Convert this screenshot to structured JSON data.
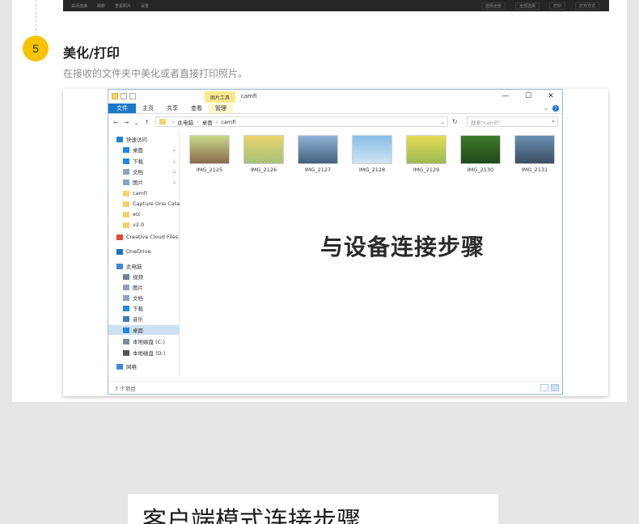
{
  "top_toolbar": {
    "left_items": [
      "关闭连接",
      "刷新",
      "查看照片",
      "设置"
    ],
    "right_items": [
      "选择全部",
      "全部选择",
      "打印",
      "打开方式"
    ]
  },
  "step": {
    "number": "5",
    "title": "美化/打印",
    "description": "在接收的文件夹中美化或者直接打印照片。"
  },
  "explorer": {
    "context_tab": "图片工具",
    "window_title": "camfi",
    "window_controls": {
      "minimize": "—",
      "maximize": "☐",
      "close": "✕"
    },
    "ribbon": {
      "file": "文件",
      "tabs": [
        "主页",
        "共享",
        "查看"
      ],
      "manage": "管理",
      "expand": "⌄",
      "help": "?"
    },
    "nav_buttons": {
      "back": "←",
      "forward": "→",
      "recent": "⌄",
      "up": "↑"
    },
    "address": {
      "segments": [
        "此电脑",
        "桌面",
        "camfi"
      ],
      "separator": "›",
      "dropdown": "⌄"
    },
    "refresh": "↻",
    "search": {
      "placeholder": "搜索\"camfi\"",
      "icon": "⌕"
    },
    "nav_items": [
      {
        "label": "快速访问",
        "icon": "star-icon",
        "color": "#2a7fd4",
        "pinned": false
      },
      {
        "label": "桌面",
        "icon": "desktop-icon",
        "color": "#1e88e5",
        "pinned": true
      },
      {
        "label": "下载",
        "icon": "download-icon",
        "color": "#1e88e5",
        "pinned": true
      },
      {
        "label": "文档",
        "icon": "document-icon",
        "color": "#8aa4c0",
        "pinned": true
      },
      {
        "label": "图片",
        "icon": "pictures-icon",
        "color": "#8aa4c0",
        "pinned": true
      },
      {
        "label": "camfi",
        "icon": "folder-icon",
        "color": "#f5d36b",
        "pinned": false
      },
      {
        "label": "Capture One Cata",
        "icon": "folder-icon",
        "color": "#f5d36b",
        "pinned": false
      },
      {
        "label": "etc",
        "icon": "folder-icon",
        "color": "#f5d36b",
        "pinned": false
      },
      {
        "label": "v2.0",
        "icon": "folder-icon",
        "color": "#f5d36b",
        "pinned": false
      },
      {
        "label": "Creative Cloud Files",
        "icon": "creative-cloud-icon",
        "color": "#e04a3a",
        "pinned": false
      },
      {
        "label": "OneDrive",
        "icon": "onedrive-icon",
        "color": "#1e70c8",
        "pinned": false
      },
      {
        "label": "此电脑",
        "icon": "computer-icon",
        "color": "#3b8ad8",
        "pinned": false
      },
      {
        "label": "视频",
        "icon": "video-icon",
        "color": "#6a7f96",
        "pinned": false
      },
      {
        "label": "图片",
        "icon": "pictures-icon",
        "color": "#8aa4c0",
        "pinned": false
      },
      {
        "label": "文档",
        "icon": "document-icon",
        "color": "#8aa4c0",
        "pinned": false
      },
      {
        "label": "下载",
        "icon": "download-icon",
        "color": "#1e88e5",
        "pinned": false
      },
      {
        "label": "音乐",
        "icon": "music-icon",
        "color": "#3a78c2",
        "pinned": false
      },
      {
        "label": "桌面",
        "icon": "desktop-icon",
        "color": "#1e88e5",
        "pinned": false,
        "selected": true
      },
      {
        "label": "本地磁盘 (C:)",
        "icon": "drive-icon",
        "color": "#7a8a99",
        "pinned": false
      },
      {
        "label": "本地磁盘 (D:)",
        "icon": "drive-icon",
        "color": "#555555",
        "pinned": false
      },
      {
        "label": "网络",
        "icon": "network-icon",
        "color": "#3b8ad8",
        "pinned": false
      }
    ],
    "pin_symbol": "⊥",
    "files": [
      {
        "name": "IMG_2125",
        "colors": [
          "#c9d98a",
          "#8a6a4a"
        ]
      },
      {
        "name": "IMG_2126",
        "colors": [
          "#e8d46a",
          "#a8c07a"
        ]
      },
      {
        "name": "IMG_2127",
        "colors": [
          "#8fb3d6",
          "#41627f"
        ]
      },
      {
        "name": "IMG_2128",
        "colors": [
          "#87bde8",
          "#cfe4f2"
        ]
      },
      {
        "name": "IMG_2129",
        "colors": [
          "#e5dc55",
          "#9cba52"
        ]
      },
      {
        "name": "IMG_2130",
        "colors": [
          "#3f7a2c",
          "#1f4a18"
        ]
      },
      {
        "name": "IMG_2131",
        "colors": [
          "#6a8eb2",
          "#3c4f64"
        ]
      }
    ],
    "overlay_text": "与设备连接步骤",
    "status_text": "7 个项目"
  },
  "banner2": {
    "title": "客户端模式连接步骤"
  }
}
